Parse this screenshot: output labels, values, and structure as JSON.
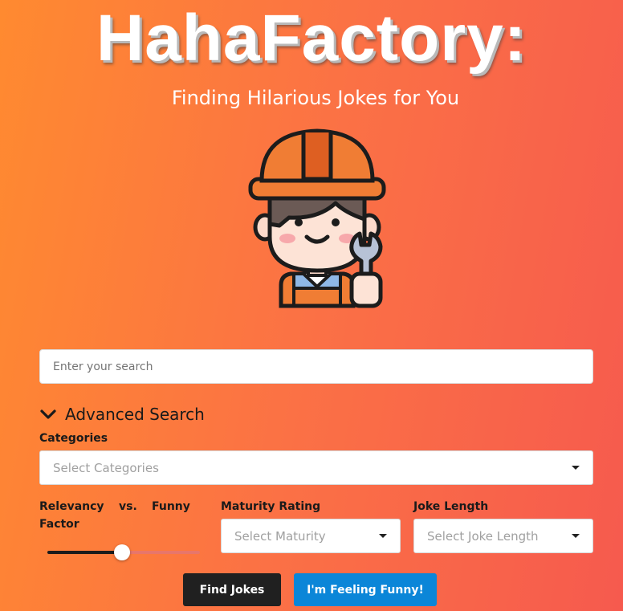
{
  "header": {
    "title": "HahaFactory:",
    "subtitle": "Finding Hilarious Jokes for You"
  },
  "mascot": {
    "icon": "construction-worker-with-wrench-icon"
  },
  "search": {
    "placeholder": "Enter your search",
    "value": ""
  },
  "advanced": {
    "toggle_label": "Advanced Search",
    "expanded": true,
    "categories": {
      "label": "Categories",
      "placeholder": "Select Categories"
    },
    "relevancy": {
      "label_left": "Relevancy",
      "label_mid": "vs.",
      "label_right": "Funny",
      "label_line2": "Factor",
      "value_fraction": 0.49
    },
    "maturity": {
      "label": "Maturity Rating",
      "placeholder": "Select Maturity"
    },
    "length": {
      "label": "Joke Length",
      "placeholder": "Select Joke Length"
    }
  },
  "actions": {
    "find_label": "Find Jokes",
    "funny_label": "I'm Feeling Funny!"
  },
  "colors": {
    "bg_start": "#ff8a30",
    "bg_end": "#f65a4e",
    "find_button": "#202020",
    "funny_button": "#0b86d8"
  }
}
